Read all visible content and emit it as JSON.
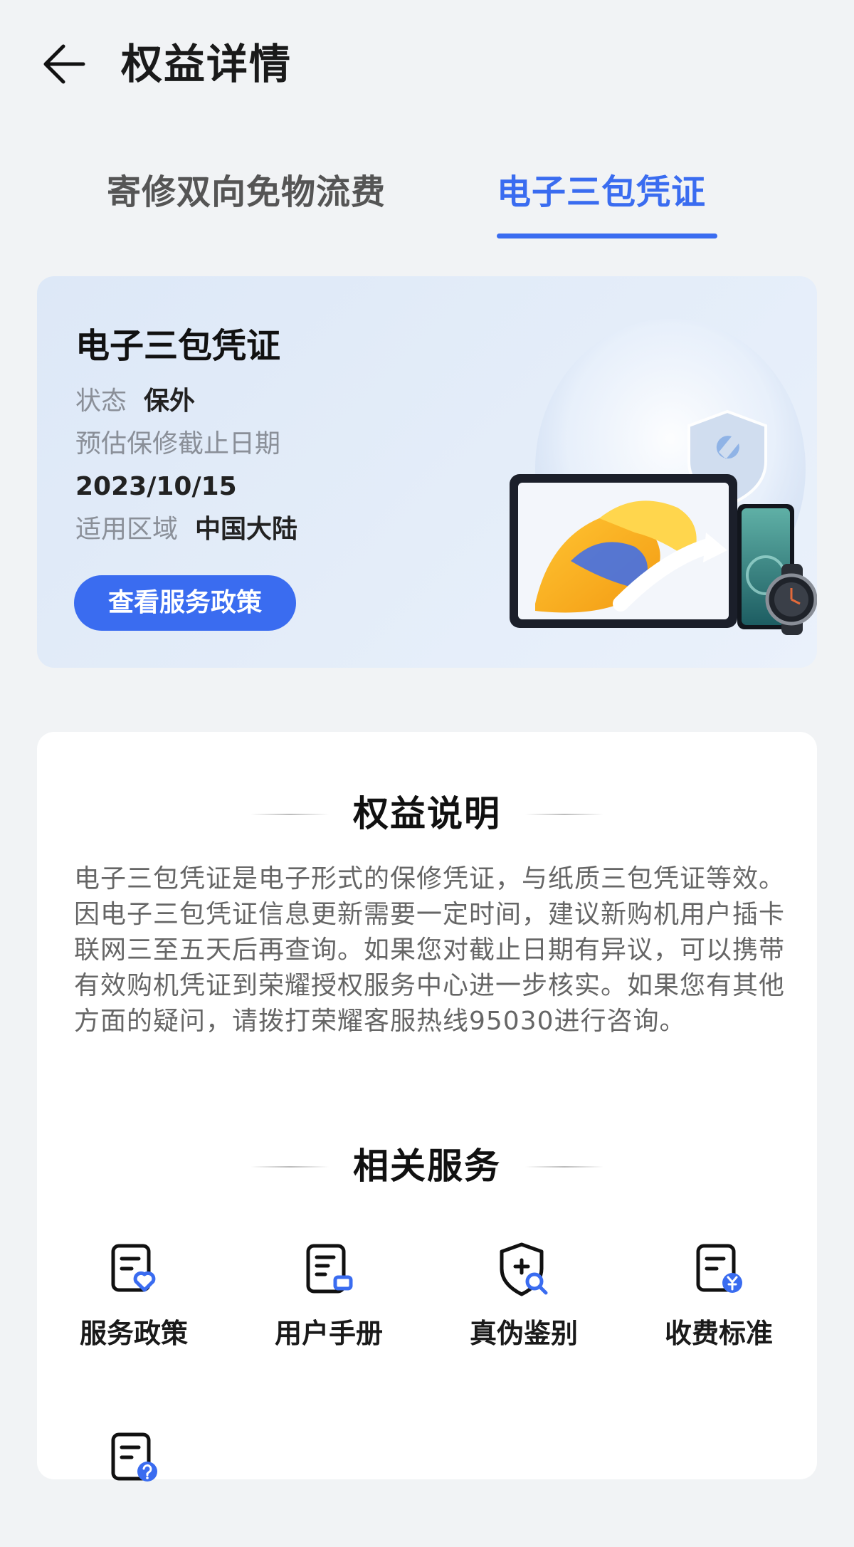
{
  "header": {
    "back_icon": "arrow-left-icon",
    "title": "权益详情"
  },
  "tabs": [
    {
      "label": "寄修双向免物流费",
      "active": false
    },
    {
      "label": "电子三包凭证",
      "active": true
    }
  ],
  "colors": {
    "accent": "#3a6cf0",
    "background": "#f1f3f5",
    "card_bg": "#e1ebf8"
  },
  "warranty_card": {
    "title": "电子三包凭证",
    "status_label": "状态",
    "status_value": "保外",
    "expiry_label": "预估保修截止日期",
    "expiry_value": "2023/10/15",
    "region_label": "适用区域",
    "region_value": "中国大陆",
    "policy_button": "查看服务政策",
    "illustration_icons": [
      "shield-wrench-icon",
      "tablet-icon",
      "phone-icon",
      "watch-icon"
    ]
  },
  "benefits": {
    "heading": "权益说明",
    "description": "电子三包凭证是电子形式的保修凭证，与纸质三包凭证等效。因电子三包凭证信息更新需要一定时间，建议新购机用户插卡联网三至五天后再查询。如果您对截止日期有异议，可以携带有效购机凭证到荣耀授权服务中心进一步核实。如果您有其他方面的疑问，请拨打荣耀客服热线95030进行咨询。"
  },
  "related": {
    "heading": "相关服务",
    "items": [
      {
        "label": "服务政策",
        "icon": "document-heart-icon"
      },
      {
        "label": "用户手册",
        "icon": "book-icon"
      },
      {
        "label": "真伪鉴别",
        "icon": "shield-search-icon"
      },
      {
        "label": "收费标准",
        "icon": "document-yuan-icon"
      },
      {
        "label": "",
        "icon": "document-question-icon"
      }
    ]
  }
}
